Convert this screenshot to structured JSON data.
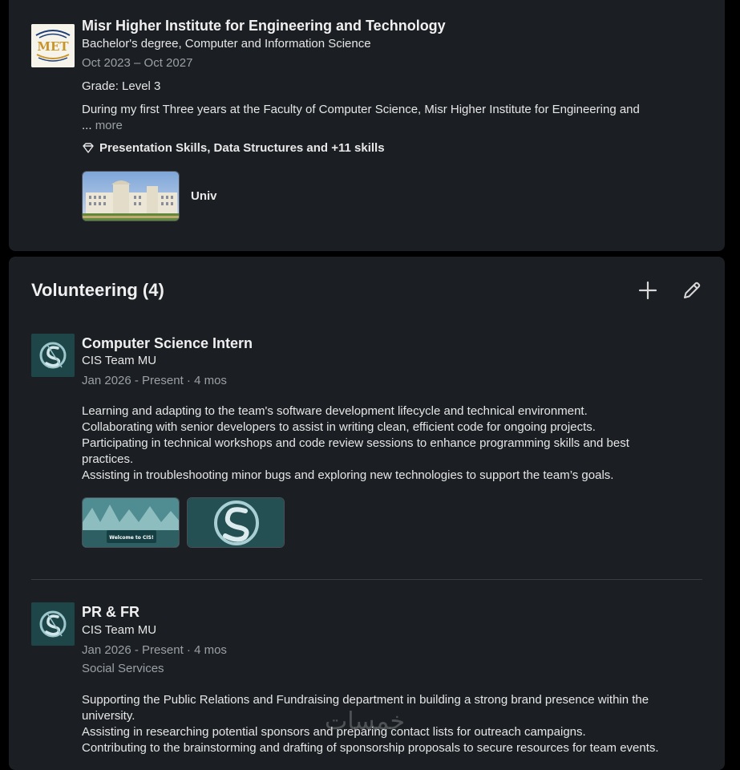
{
  "education": {
    "school": "Misr Higher Institute for Engineering and Technology",
    "logo_text": "MET",
    "degree": "Bachelor's degree, Computer and Information Science",
    "dates": "Oct 2023 – Oct 2027",
    "grade": "Grade: Level 3",
    "description": "During my first Three years at the Faculty of Computer Science, Misr Higher Institute for Engineering and",
    "ellipsis": "...",
    "more_label": "more",
    "skills": "Presentation Skills, Data Structures and +11 skills",
    "media_label": "Univ"
  },
  "volunteering": {
    "title": "Volunteering (4)",
    "entries": [
      {
        "role": "Computer Science Intern",
        "org": "CIS Team MU",
        "dates": "Jan 2026 - Present · 4 mos",
        "lines": [
          "Learning and adapting to the team's software development lifecycle and technical environment.",
          "Collaborating with senior developers to assist in writing clean, efficient code for ongoing projects.",
          "Participating in technical workshops and code review sessions to enhance programming skills and best practices.",
          "Assisting in troubleshooting minor bugs and exploring new technologies to support the team’s goals."
        ],
        "media": {
          "welcome_text": "Welcome to CIS!"
        }
      },
      {
        "role": "PR & FR",
        "org": "CIS Team MU",
        "dates": "Jan 2026 - Present · 4 mos",
        "cause": "Social Services",
        "lines": [
          "Supporting the Public Relations and Fundraising department in building a strong brand presence within the university.",
          "Assisting in researching potential sponsors and preparing contact lists for outreach campaigns.",
          "Contributing to the brainstorming and drafting of sponsorship proposals to secure resources for team events."
        ]
      }
    ]
  },
  "watermark": "خمسات",
  "colors": {
    "page_bg": "#000000",
    "card_bg": "#1b1f23",
    "muted_text": "#9aa0a6",
    "divider": "#3a3d40"
  }
}
